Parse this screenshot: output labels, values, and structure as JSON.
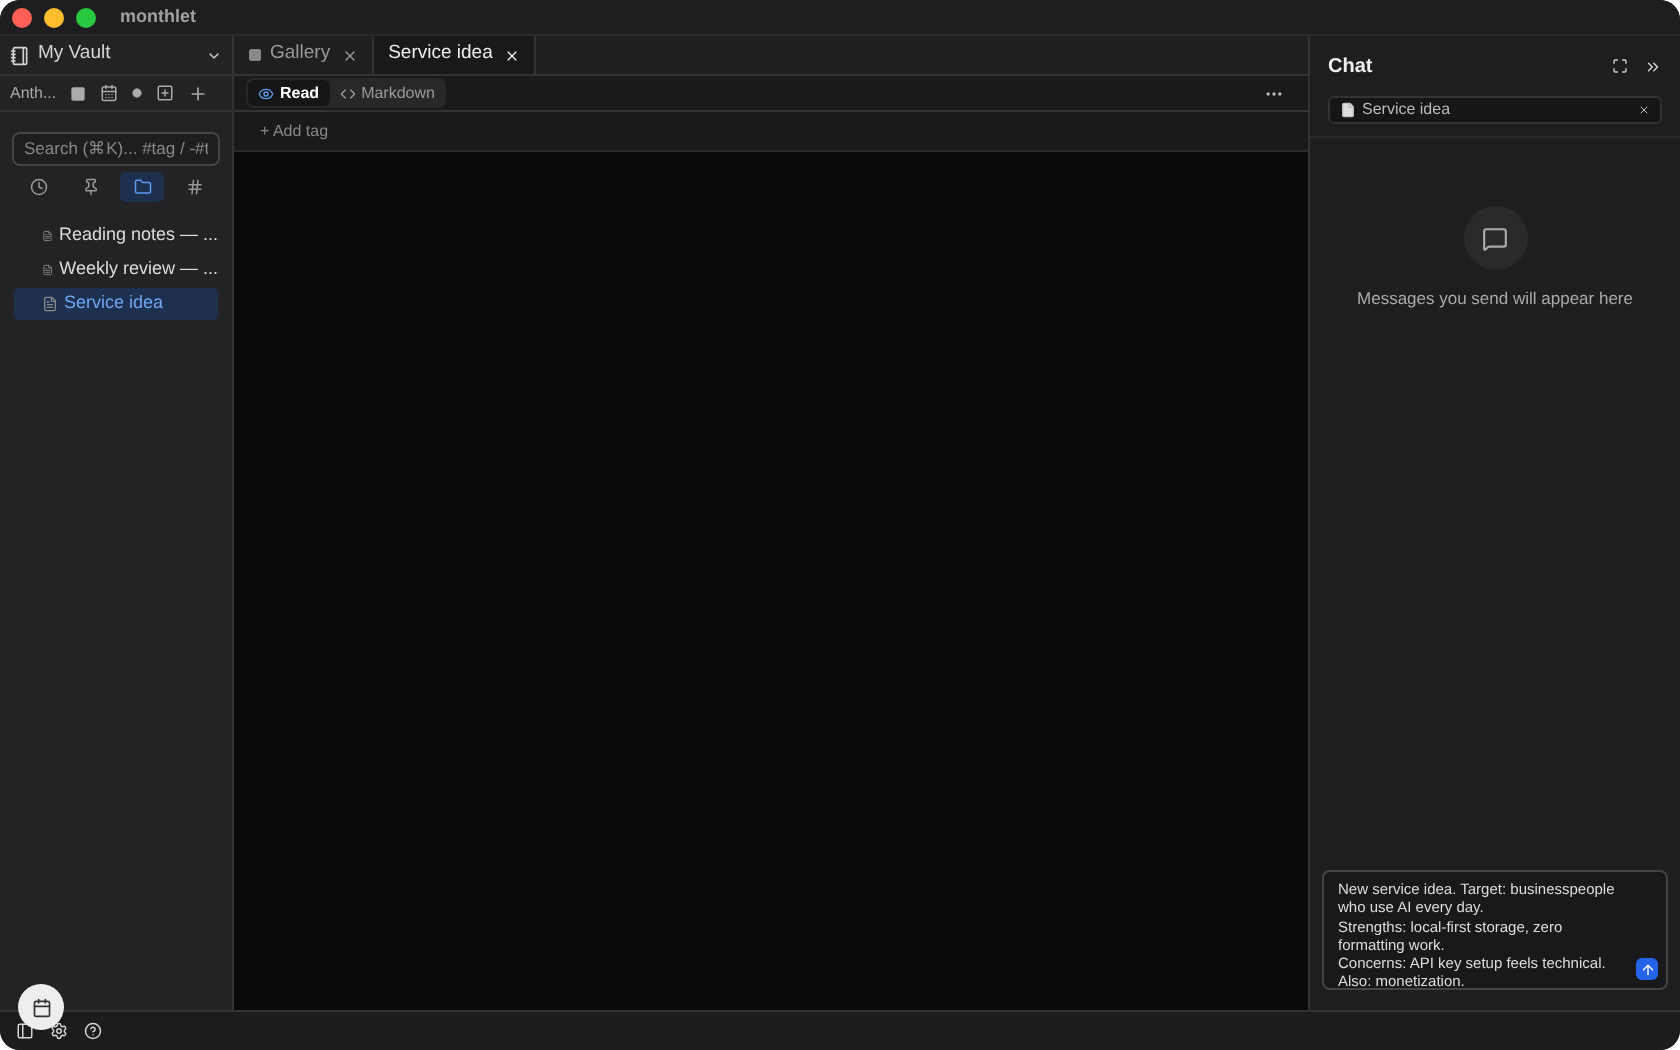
{
  "window": {
    "title": "monthlet"
  },
  "sidebar": {
    "vault": "My Vault",
    "toolbar_label": "Anth...",
    "search": {
      "placeholder": "Search (⌘K)... #tag / -#t"
    },
    "view_tabs": [
      {
        "kind": "recent",
        "selected": false
      },
      {
        "kind": "pinned",
        "selected": false
      },
      {
        "kind": "folders",
        "selected": true
      },
      {
        "kind": "tags",
        "selected": false
      }
    ],
    "items": [
      {
        "label": "Reading notes — ...",
        "selected": false
      },
      {
        "label": "Weekly review — ...",
        "selected": false
      },
      {
        "label": "Service idea",
        "selected": true
      }
    ]
  },
  "tabs": [
    {
      "label": "Gallery",
      "kind": "gallery",
      "selected": false
    },
    {
      "label": "Service idea",
      "kind": "note",
      "selected": true
    }
  ],
  "modes": [
    {
      "label": "Read",
      "kind": "read",
      "selected": true
    },
    {
      "label": "Markdown",
      "kind": "code",
      "selected": false
    }
  ],
  "add_tag": "+ Add tag",
  "chat": {
    "title": "Chat",
    "context": "Service idea",
    "empty": "Messages you send will appear here",
    "input_lines": [
      "New service idea. Target: businesspeople",
      "who use AI every day.",
      "Strengths: local-first storage, zero",
      "formatting work.",
      "Concerns: API key setup feels technical.",
      "Also: monetization."
    ]
  }
}
